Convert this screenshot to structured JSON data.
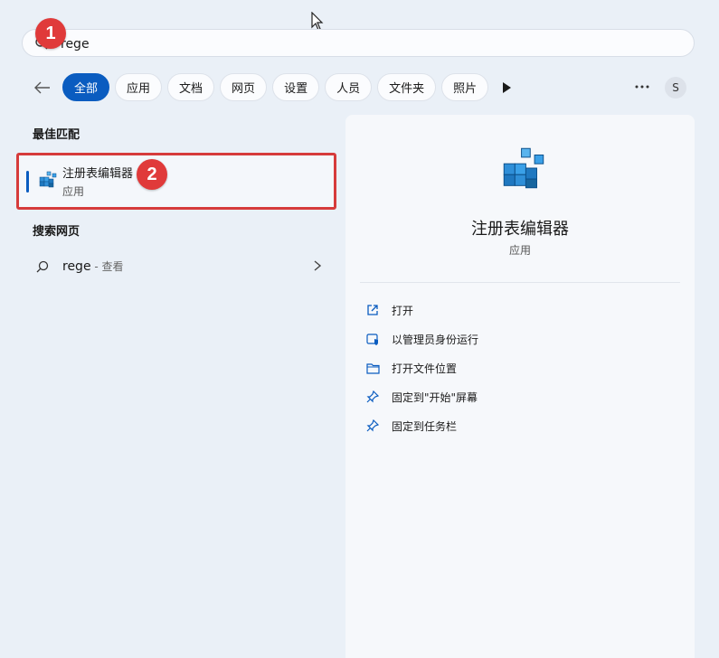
{
  "search": {
    "value": "rege",
    "placeholder": ""
  },
  "badges": {
    "first": "1",
    "second": "2"
  },
  "filters": {
    "chips": [
      "全部",
      "应用",
      "文档",
      "网页",
      "设置",
      "人员",
      "文件夹",
      "照片"
    ],
    "active_index": 0
  },
  "account": {
    "initial": "S"
  },
  "best_match": {
    "section_title": "最佳匹配",
    "name": "注册表编辑器",
    "type": "应用",
    "icon": "registry-editor-icon"
  },
  "web_search": {
    "section_title": "搜索网页",
    "query": "rege",
    "suffix": " - 查看"
  },
  "detail": {
    "name": "注册表编辑器",
    "type": "应用",
    "actions": [
      {
        "label": "打开",
        "icon": "open-external-icon"
      },
      {
        "label": "以管理员身份运行",
        "icon": "admin-shield-icon"
      },
      {
        "label": "打开文件位置",
        "icon": "folder-icon"
      },
      {
        "label": "固定到\"开始\"屏幕",
        "icon": "pin-icon"
      },
      {
        "label": "固定到任务栏",
        "icon": "pin-icon"
      }
    ]
  },
  "colors": {
    "accent": "#0a5cc0",
    "annotation": "#e03a3a"
  }
}
